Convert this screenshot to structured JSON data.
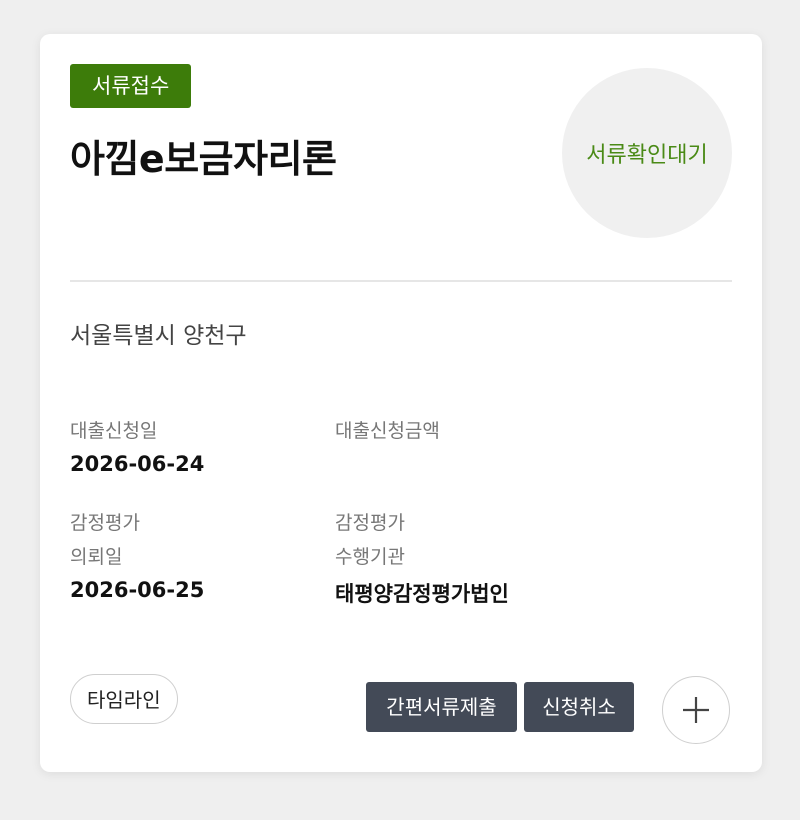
{
  "card": {
    "status_tag": "서류접수",
    "product_title": "아낌e보금자리론",
    "progress_status": "서류확인대기",
    "address": "서울특별시 양천구",
    "fields": {
      "loan_date_label": "대출신청일",
      "loan_date_value": "2026-06-24",
      "loan_amount_label": "대출신청금액",
      "appraisal_request_label_line1": "감정평가",
      "appraisal_request_label_line2": "의뢰일",
      "appraisal_request_value": "2026-06-25",
      "appraisal_agency_label_line1": "감정평가",
      "appraisal_agency_label_line2": "수행기관",
      "appraisal_agency_value": "태평양감정평가법인"
    },
    "buttons": {
      "timeline": "타임라인",
      "simple_submit": "간편서류제출",
      "cancel_application": "신청취소",
      "more_icon": "plus-icon"
    },
    "colors": {
      "status_green": "#3d7c0a",
      "progress_text_green": "#4a8a16",
      "dark_button": "#434a57"
    }
  }
}
